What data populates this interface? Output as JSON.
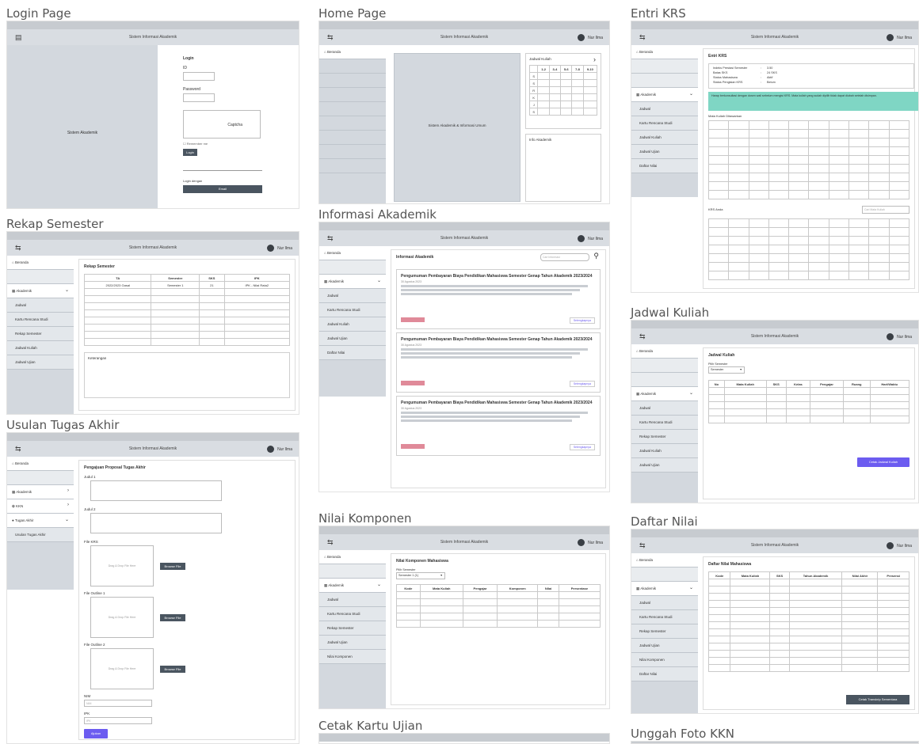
{
  "common": {
    "header_title": "Sistem Informasi Akademik",
    "user_name": "Nur Ilma",
    "menu_icon": "menu-icon",
    "user_icon": "user-avatar-icon",
    "side_beranda": "Beranda",
    "side_akademik": "Akademik",
    "side_jadwal": "Jadwal",
    "side_krs": "Kartu Rencana Studi",
    "side_rekap": "Rekap Semester",
    "side_jadwal_kuliah": "Jadwal Kuliah",
    "side_jadwal_ujian": "Jadwal Ujian",
    "side_nilai_komponen": "Nilai Komponen",
    "side_daftar_nilai": "Daftar Nilai"
  },
  "login": {
    "frame_title": "Login Page",
    "left_text": "Sistem Akademik",
    "heading": "Login",
    "id_label": "ID",
    "password_label": "Password",
    "captcha": "Captcha",
    "remember": "Remember me",
    "login_button": "Login",
    "google_label": "Login dengan",
    "google_button": "Email"
  },
  "home": {
    "frame_title": "Home Page",
    "center_text": "Sistem Akademik & Informasi Umum",
    "calendar_title": "Jadwal Kuliah",
    "calendar_next": "›",
    "calendar_cols": [
      "",
      "1-2",
      "3-4",
      "5-6",
      "7-8",
      "9-10"
    ],
    "calendar_rows": [
      "S",
      "S",
      "R",
      "K",
      "J",
      "S"
    ],
    "info_title": "Info Akademik"
  },
  "krs": {
    "frame_title": "Entri KRS",
    "page_title": "Entri KRS",
    "info_rows": [
      {
        "label": "Indeks Prestasi Semester",
        "value": "3.50"
      },
      {
        "label": "Batas SKS",
        "value": "24 SKS"
      },
      {
        "label": "Status Mahasiswa",
        "value": "Aktif"
      },
      {
        "label": "Status Pengisian KRS",
        "value": "Belum"
      }
    ],
    "notice": "Harap berkonsultasi dengan dosen wali sebelum mengisi KRS. Mata kuliah yang sudah dipilih tidak dapat diubah setelah disimpan.",
    "offered_title": "Mata Kuliah Ditawarkan",
    "selected_title": "KRS Anda",
    "search_placeholder": "Cari Mata Kuliah"
  },
  "rekap": {
    "frame_title": "Rekap Semester",
    "page_title": "Rekap Semester",
    "columns": [
      "TA",
      "Semester",
      "SKS",
      "IPK"
    ],
    "rows": [
      [
        "2022/2023 Gasal",
        "Semester 1",
        "21",
        "IPK - Nilai Rata2"
      ]
    ],
    "note_title": "Keterangan"
  },
  "info": {
    "frame_title": "Informasi Akademik",
    "page_title": "Informasi Akademik",
    "search_placeholder": "Cari Informasi",
    "search_icon": "search-icon",
    "articles": [
      {
        "title": "Pengumuman Pembayaran Biaya Pendidikan Mahasiswa Semester Genap Tahun Akademik 2023/2024",
        "date": "30 Agustus 2023",
        "more": "Selengkapnya"
      },
      {
        "title": "Pengumuman Pembayaran Biaya Pendidikan Mahasiswa Semester Genap Tahun Akademik 2023/2024",
        "date": "30 Agustus 2023",
        "more": "Selengkapnya"
      },
      {
        "title": "Pengumuman Pembayaran Biaya Pendidikan Mahasiswa Semester Genap Tahun Akademik 2023/2024",
        "date": "30 Agustus 2023",
        "more": "Selengkapnya"
      }
    ]
  },
  "jadwal": {
    "frame_title": "Jadwal Kuliah",
    "page_title": "Jadwal Kuliah",
    "select_label": "Pilih Semester",
    "select_value": "Semester",
    "columns": [
      "No",
      "Mata Kuliah",
      "SKS",
      "Kelas",
      "Pengajar",
      "Ruang",
      "Hari/Waktu"
    ],
    "print_button": "Cetak Jadwal Kuliah"
  },
  "usulan": {
    "frame_title": "Usulan Tugas Akhir",
    "page_title": "Pengajuan Proposal Tugas Akhir",
    "side_ta": "Tugas Akhir",
    "side_kkn": "KKN",
    "side_usulan": "Usulan Tugas Akhir",
    "judul1": "Judul 1",
    "judul2": "Judul 2",
    "file_krs": "File KRS",
    "file_outline1": "File Outline 1",
    "file_outline2": "File Outline 2",
    "drop_text": "Drag & Drop File Here",
    "upload_button": "Browse File",
    "nim_label": "NIM",
    "nim_placeholder": "NIM",
    "ipk_label": "IPK",
    "ipk_placeholder": "IPK",
    "submit_button": "Ajukan"
  },
  "nilai_komponen": {
    "frame_title": "Nilai Komponen",
    "page_title": "Nilai Komponen Mahasiswa",
    "select_label": "Pilih Semester",
    "select_value": "Semester 1 (1)",
    "columns": [
      "Kode",
      "Mata Kuliah",
      "Pengajar",
      "Komponen",
      "Nilai",
      "Persentase"
    ]
  },
  "daftar_nilai": {
    "frame_title": "Daftar Nilai",
    "page_title": "Daftar Nilai Mahasiswa",
    "columns": [
      "Kode",
      "Mata Kuliah",
      "SKS",
      "Tahun Akademik",
      "Nilai Akhir",
      "Presensi"
    ],
    "print_button": "Cetak Transkrip Sementara"
  },
  "cetak": {
    "frame_title": "Cetak Kartu Ujian"
  },
  "unggah": {
    "frame_title": "Unggah Foto KKN"
  }
}
